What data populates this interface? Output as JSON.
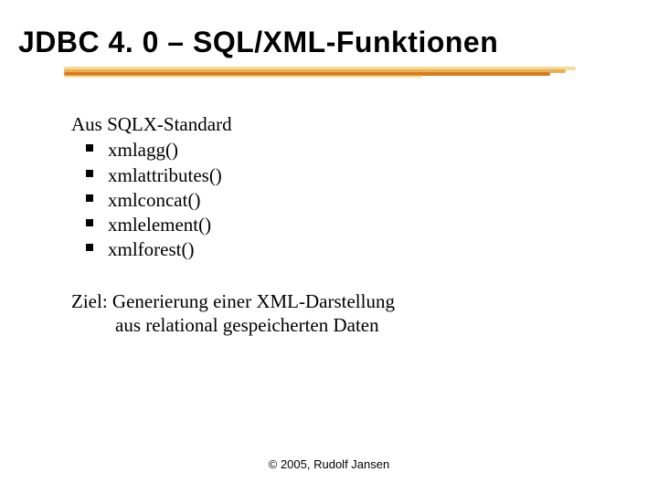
{
  "title": "JDBC 4. 0 – SQL/XML-Funktionen",
  "intro": "Aus SQLX-Standard",
  "functions": {
    "f0": "xmlagg()",
    "f1": "xmlattributes()",
    "f2": "xmlconcat()",
    "f3": "xmlelement()",
    "f4": "xmlforest()"
  },
  "goal": {
    "line1": "Ziel: Generierung einer XML-Darstellung",
    "line2": "aus relational gespeicherten Daten"
  },
  "footer": "© 2005, Rudolf Jansen"
}
